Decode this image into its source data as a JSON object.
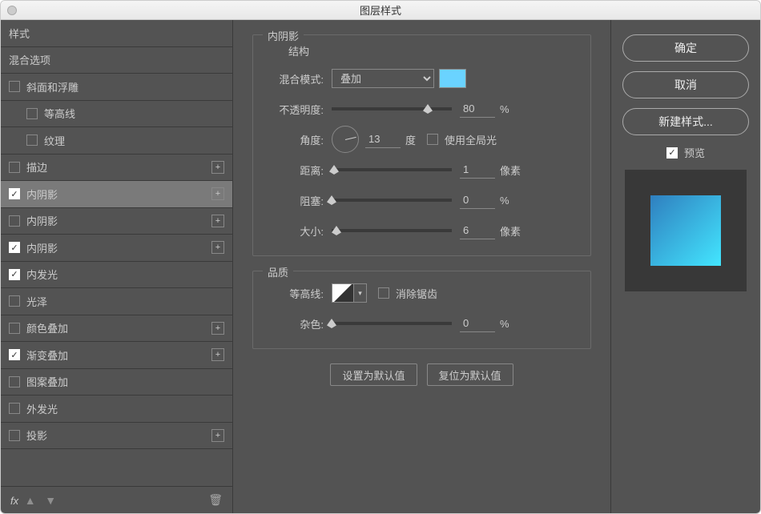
{
  "window": {
    "title": "图层样式"
  },
  "sidebar": {
    "header_styles": "样式",
    "header_blend": "混合选项",
    "items": [
      {
        "label": "斜面和浮雕",
        "checked": false,
        "plus": false
      },
      {
        "label": "等高线",
        "checked": false,
        "indent": true
      },
      {
        "label": "纹理",
        "checked": false,
        "indent": true
      },
      {
        "label": "描边",
        "checked": false,
        "plus": true
      },
      {
        "label": "内阴影",
        "checked": true,
        "plus": true,
        "selected": true
      },
      {
        "label": "内阴影",
        "checked": false,
        "plus": true
      },
      {
        "label": "内阴影",
        "checked": true,
        "plus": true
      },
      {
        "label": "内发光",
        "checked": true
      },
      {
        "label": "光泽",
        "checked": false
      },
      {
        "label": "颜色叠加",
        "checked": false,
        "plus": true
      },
      {
        "label": "渐变叠加",
        "checked": true,
        "plus": true
      },
      {
        "label": "图案叠加",
        "checked": false
      },
      {
        "label": "外发光",
        "checked": false
      },
      {
        "label": "投影",
        "checked": false,
        "plus": true
      }
    ],
    "fx": "fx"
  },
  "main": {
    "group_label": "内阴影",
    "structure_label": "结构",
    "blend_mode_label": "混合模式:",
    "blend_mode_value": "叠加",
    "color": "#6ad3ff",
    "opacity_label": "不透明度:",
    "opacity_value": "80",
    "opacity_unit": "%",
    "angle_label": "角度:",
    "angle_value": "13",
    "angle_unit": "度",
    "global_light_label": "使用全局光",
    "distance_label": "距离:",
    "distance_value": "1",
    "distance_unit": "像素",
    "choke_label": "阻塞:",
    "choke_value": "0",
    "choke_unit": "%",
    "size_label": "大小:",
    "size_value": "6",
    "size_unit": "像素",
    "quality_label": "品质",
    "contour_label": "等高线:",
    "antialias_label": "消除锯齿",
    "noise_label": "杂色:",
    "noise_value": "0",
    "noise_unit": "%",
    "btn_default": "设置为默认值",
    "btn_reset": "复位为默认值"
  },
  "right": {
    "ok": "确定",
    "cancel": "取消",
    "new_style": "新建样式...",
    "preview": "预览"
  }
}
